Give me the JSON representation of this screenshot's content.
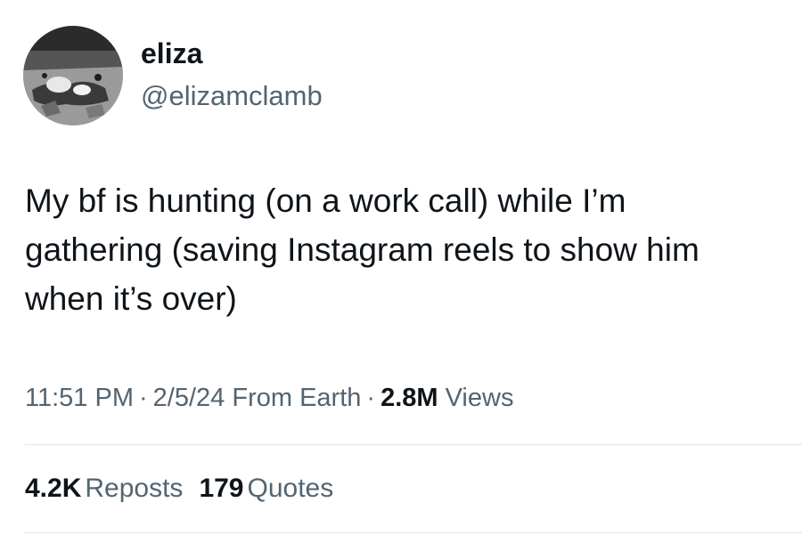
{
  "author": {
    "display_name": "eliza",
    "handle": "@elizamclamb",
    "avatar_icon": "avatar-photo"
  },
  "tweet": {
    "text": "My bf is hunting (on a work call) while I’m\ngathering (saving Instagram reels to show him\nwhen it’s over)",
    "time": "11:51 PM",
    "separator": "·",
    "date": "2/5/24",
    "source": "From Earth",
    "views_count": "2.8M",
    "views_label": "Views"
  },
  "stats": {
    "reposts_count": "4.2K",
    "reposts_label": "Reposts",
    "quotes_count": "179",
    "quotes_label": "Quotes"
  },
  "colors": {
    "primary_text": "#0f1419",
    "secondary_text": "#536471",
    "divider": "#e1e4e6",
    "background": "#ffffff"
  }
}
